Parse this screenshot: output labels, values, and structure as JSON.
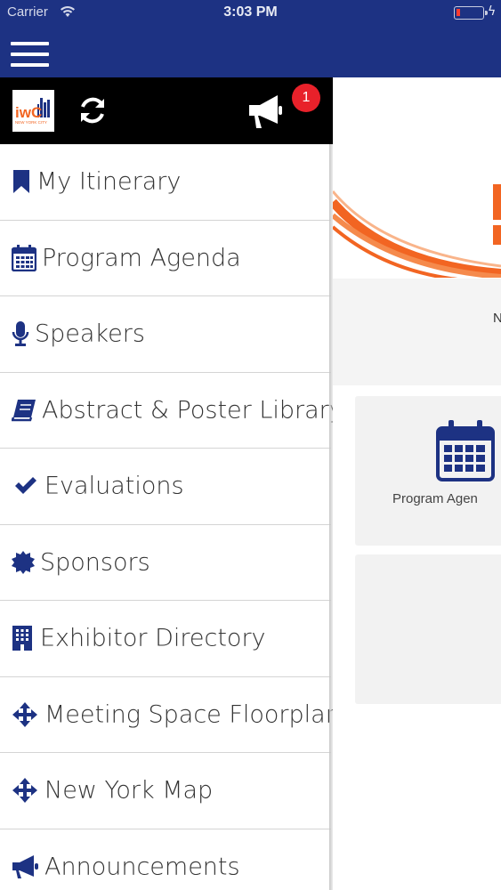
{
  "status_bar": {
    "carrier": "Carrier",
    "time": "3:03 PM",
    "battery_color": "#ff3b30"
  },
  "nav_bar": {
    "background": "#1d3283",
    "menu_icon": "hamburger-icon"
  },
  "drawer_header": {
    "logo_text": "iwC",
    "logo_subtext": "NEW YORK CITY",
    "sync_icon": "sync-icon",
    "announcements_icon": "megaphone-icon",
    "badge_count": "1",
    "badge_color": "#e8212a"
  },
  "menu": {
    "items": [
      {
        "label": "My Itinerary",
        "icon": "bookmark-icon"
      },
      {
        "label": "Program Agenda",
        "icon": "calendar-icon"
      },
      {
        "label": "Speakers",
        "icon": "microphone-icon"
      },
      {
        "label": "Abstract & Poster Library",
        "icon": "book-icon"
      },
      {
        "label": "Evaluations",
        "icon": "checkmark-icon"
      },
      {
        "label": "Sponsors",
        "icon": "certificate-icon"
      },
      {
        "label": "Exhibitor Directory",
        "icon": "building-icon"
      },
      {
        "label": "Meeting Space Floorplan",
        "icon": "move-arrows-icon"
      },
      {
        "label": "New York Map",
        "icon": "move-arrows-icon"
      },
      {
        "label": "Announcements",
        "icon": "megaphone-icon"
      }
    ],
    "icon_color": "#1d3283"
  },
  "content": {
    "info_text_fragment": "N",
    "tiles": [
      {
        "label": "Program Agen",
        "icon": "calendar-icon"
      }
    ],
    "accent": "#f26522"
  }
}
